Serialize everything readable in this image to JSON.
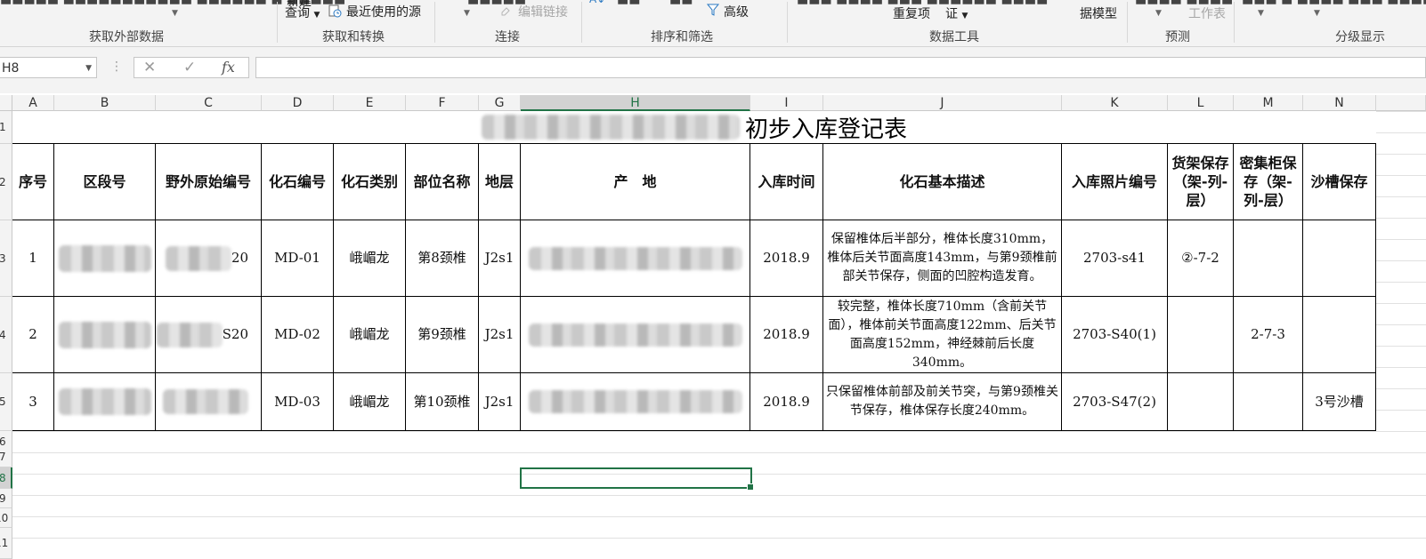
{
  "ribbon": {
    "query_label": "查询",
    "new_query_label": "新建",
    "recent_sources_label": "最近使用的源",
    "edit_links_label": "编辑链接",
    "advanced_label": "高级",
    "remove_duplicates_label": "重复项",
    "validation_label": "证",
    "data_model_label": "据模型",
    "worksheet_label": "工作表",
    "groups": {
      "external": "获取外部数据",
      "transform": "获取和转换",
      "connections": "连接",
      "sortfilter": "排序和筛选",
      "datatools": "数据工具",
      "forecast": "预测",
      "outline": "分级显示"
    }
  },
  "formula_bar": {
    "name_box": "H8",
    "cancel_icon": "✕",
    "enter_icon": "✓",
    "fx_label": "fx",
    "formula_value": ""
  },
  "columns": [
    "A",
    "B",
    "C",
    "D",
    "E",
    "F",
    "G",
    "H",
    "I",
    "J",
    "K",
    "L",
    "M",
    "N"
  ],
  "selected_column": "H",
  "rows": [
    "1",
    "2",
    "3",
    "4",
    "5",
    "6",
    "7",
    "8",
    "9",
    "10",
    "11"
  ],
  "selected_row": "8",
  "sheet": {
    "title": "初步入库登记表",
    "headers": [
      "序号",
      "区段号",
      "野外原始编号",
      "化石编号",
      "化石类别",
      "部位名称",
      "地层",
      "产　地",
      "入库时间",
      "化石基本描述",
      "入库照片编号",
      "货架保存（架-列-层）",
      "密集柜保存（架-列-层）",
      "沙槽保存"
    ],
    "records": [
      {
        "no": "1",
        "field_suffix": "20",
        "fossil_no": "MD-01",
        "category": "峨嵋龙",
        "part": "第8颈椎",
        "stratum": "J2s1",
        "date": "2018.9",
        "description": "保留椎体后半部分，椎体长度310mm，椎体后关节面高度143mm，与第9颈椎前部关节保存，侧面的凹腔构造发育。",
        "photo_no": "2703-s41",
        "shelf": "②-7-2",
        "cabinet": "",
        "sand": ""
      },
      {
        "no": "2",
        "field_suffix": "S20",
        "fossil_no": "MD-02",
        "category": "峨嵋龙",
        "part": "第9颈椎",
        "stratum": "J2s1",
        "date": "2018.9",
        "description": "较完整，椎体长度710mm（含前关节面），椎体前关节面高度122mm、后关节面高度152mm，神经棘前后长度340mm。",
        "photo_no": "2703-S40(1)",
        "shelf": "",
        "cabinet": "2-7-3",
        "sand": ""
      },
      {
        "no": "3",
        "field_suffix": "",
        "fossil_no": "MD-03",
        "category": "峨嵋龙",
        "part": "第10颈椎",
        "stratum": "J2s1",
        "date": "2018.9",
        "description": "只保留椎体前部及前关节突，与第9颈椎关节保存，椎体保存长度240mm。",
        "photo_no": "2703-S47(2)",
        "shelf": "",
        "cabinet": "",
        "sand": "3号沙槽"
      }
    ]
  },
  "colors": {
    "excel_green": "#217346",
    "ribbon_bg": "#f3f3f3",
    "grid_line": "#e1e1e1"
  }
}
